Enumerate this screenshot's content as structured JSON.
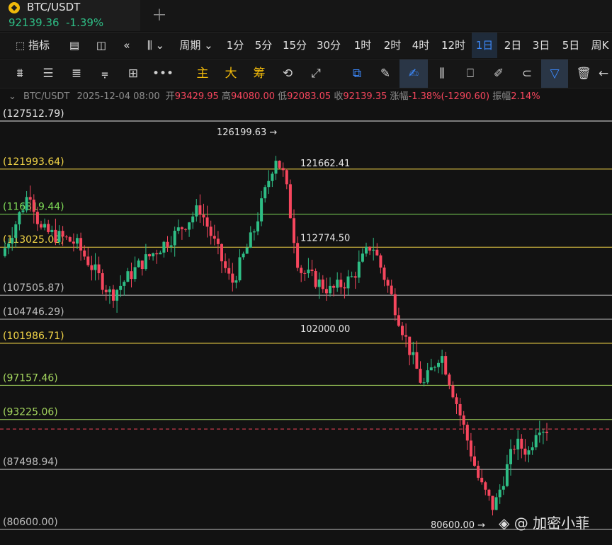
{
  "tab": {
    "symbol": "BTC/USDT",
    "price": "92139.36",
    "change": "-1.39%"
  },
  "toolbar_periods": {
    "indicators": "指标",
    "cycle": "周期",
    "items": [
      "1分",
      "5分",
      "15分",
      "30分",
      "1时",
      "2时",
      "4时",
      "12时",
      "1日",
      "2日",
      "3日",
      "5日",
      "周K"
    ],
    "active": "1日"
  },
  "toolbar_tools": {
    "zhu": "主",
    "da": "大",
    "chou": "筹"
  },
  "info": {
    "symbol": "BTC/USDT",
    "datetime": "2025-12-04 08:00",
    "open_label": "开",
    "open": "93429.95",
    "high_label": "高",
    "high": "94080.00",
    "low_label": "低",
    "low": "92083.05",
    "close_label": "收",
    "close": "92139.35",
    "chg_label": "涨幅",
    "chg": "-1.38%(-1290.60)",
    "amp_label": "振幅",
    "amp": "2.14%"
  },
  "levels": [
    {
      "value": 127512.79,
      "label": "(127512.79)",
      "color": "#e6e6e6"
    },
    {
      "value": 121993.64,
      "label": "(121993.64)",
      "color": "#f1d447"
    },
    {
      "value": 116819.44,
      "label": "(116819.44)",
      "color": "#7ed957"
    },
    {
      "value": 113025.02,
      "label": "(113025.02)",
      "color": "#f1d447"
    },
    {
      "value": 107505.87,
      "label": "(107505.87)",
      "color": "#bdbdbd"
    },
    {
      "value": 104746.29,
      "label": "(104746.29)",
      "color": "#bdbdbd"
    },
    {
      "value": 101986.71,
      "label": "(101986.71)",
      "color": "#f1d447"
    },
    {
      "value": 97157.46,
      "label": "(97157.46)",
      "color": "#a4d65e"
    },
    {
      "value": 93225.06,
      "label": "(93225.06)",
      "color": "#a4d65e"
    },
    {
      "value": 87498.94,
      "label": "(87498.94)",
      "color": "#bdbdbd"
    },
    {
      "value": 80600.0,
      "label": "(80600.00)",
      "color": "#bdbdbd"
    }
  ],
  "annotations": {
    "high": "126199.63",
    "low": "80600.00",
    "a1": "121662.41",
    "a2": "112774.50",
    "a3": "102000.00"
  },
  "current_price_line": 92139.35,
  "watermark": "@ 加密小菲",
  "colors": {
    "up": "#2ebd85",
    "down": "#f6465d",
    "accent": "#3d8bff",
    "brand": "#f0b90b"
  }
}
